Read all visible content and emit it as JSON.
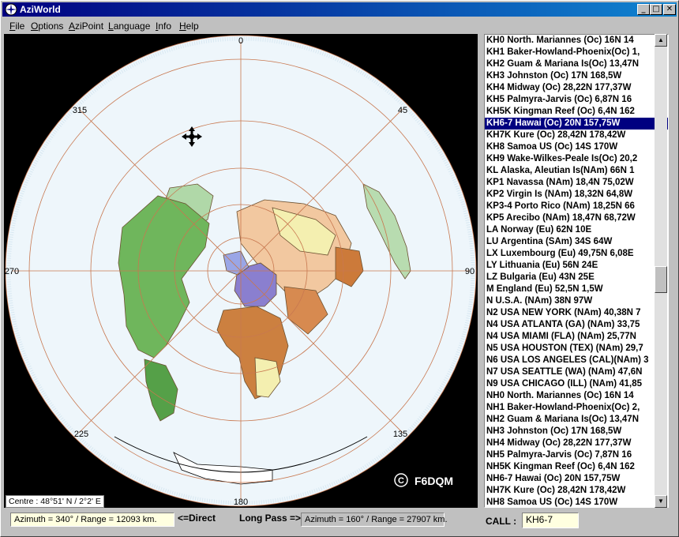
{
  "window": {
    "title": "AziWorld",
    "icon": "globe-icon",
    "controls": {
      "minimize": "_",
      "maximize": "□",
      "close": "✕"
    }
  },
  "menu": [
    "File",
    "Options",
    "AziPoint",
    "Language",
    "Info",
    "Help"
  ],
  "map": {
    "bearing_labels": [
      "0",
      "45",
      "90",
      "135",
      "180",
      "225",
      "270",
      "315"
    ],
    "copyright_symbol": "C",
    "author": "F6DQM",
    "centre": "Centre : 48°51' N / 2°2' E",
    "colors": {
      "ocean": "#eef6fb",
      "grid": "#c87850",
      "background": "#000000"
    }
  },
  "list": {
    "selected_index": 7,
    "items": [
      "KH0 North. Mariannes (Oc) 16N 14",
      "KH1 Baker-Howland-Phoenix(Oc) 1,",
      "KH2 Guam & Mariana Is(Oc) 13,47N",
      "KH3 Johnston (Oc) 17N 168,5W",
      "KH4 Midway (Oc) 28,22N 177,37W",
      "KH5 Palmyra-Jarvis (Oc) 6,87N 16",
      "KH5K Kingman Reef (Oc) 6,4N 162",
      "KH6-7 Hawai (Oc) 20N 157,75W",
      "KH7K Kure (Oc) 28,42N 178,42W",
      "KH8 Samoa US (Oc) 14S 170W",
      "KH9 Wake-Wilkes-Peale Is(Oc) 20,2",
      "KL Alaska, Aleutian Is(NAm) 66N 1",
      "KP1 Navassa (NAm) 18,4N 75,02W",
      "KP2 Virgin Is (NAm) 18,32N 64,8W",
      "KP3-4 Porto Rico (NAm) 18,25N 66",
      "KP5 Arecibo (NAm) 18,47N 68,72W",
      "LA Norway (Eu) 62N 10E",
      "LU Argentina (SAm) 34S 64W",
      "LX Luxembourg (Eu) 49,75N 6,08E",
      "LY Lithuania (Eu) 56N 24E",
      "LZ Bulgaria (Eu) 43N 25E",
      "M England (Eu) 52,5N 1,5W",
      "N U.S.A. (NAm) 38N 97W",
      "N2 USA NEW YORK (NAm) 40,38N 7",
      "N4 USA ATLANTA (GA) (NAm) 33,75",
      "N4 USA MIAMI (FLA) (NAm) 25,77N",
      "N5 USA HOUSTON (TEX) (NAm) 29,7",
      "N6 USA LOS ANGELES (CAL)(NAm) 3",
      "N7 USA SEATTLE (WA) (NAm) 47,6N",
      "N9 USA CHICAGO (ILL) (NAm) 41,85",
      "NH0 North. Mariannes (Oc) 16N 14",
      "NH1 Baker-Howland-Phoenix(Oc) 2,",
      "NH2 Guam & Mariana Is(Oc) 13,47N",
      "NH3 Johnston (Oc) 17N 168,5W",
      "NH4 Midway (Oc) 28,22N 177,37W",
      "NH5 Palmyra-Jarvis (Oc) 7,87N 16",
      "NH5K Kingman Reef (Oc) 6,4N 162",
      "NH6-7 Hawai (Oc) 20N 157,75W",
      "NH7K Kure (Oc) 28,42N 178,42W",
      "NH8 Samoa US (Oc) 14S 170W"
    ]
  },
  "status": {
    "short_path": "Azimuth = 340° / Range = 12093 km.",
    "direct_label": "<=Direct",
    "long_pass_label": "Long Pass =>",
    "long_path": "Azimuth = 160° / Range = 27907 km.",
    "call_label": "CALL :",
    "call_value": "KH6-7"
  }
}
